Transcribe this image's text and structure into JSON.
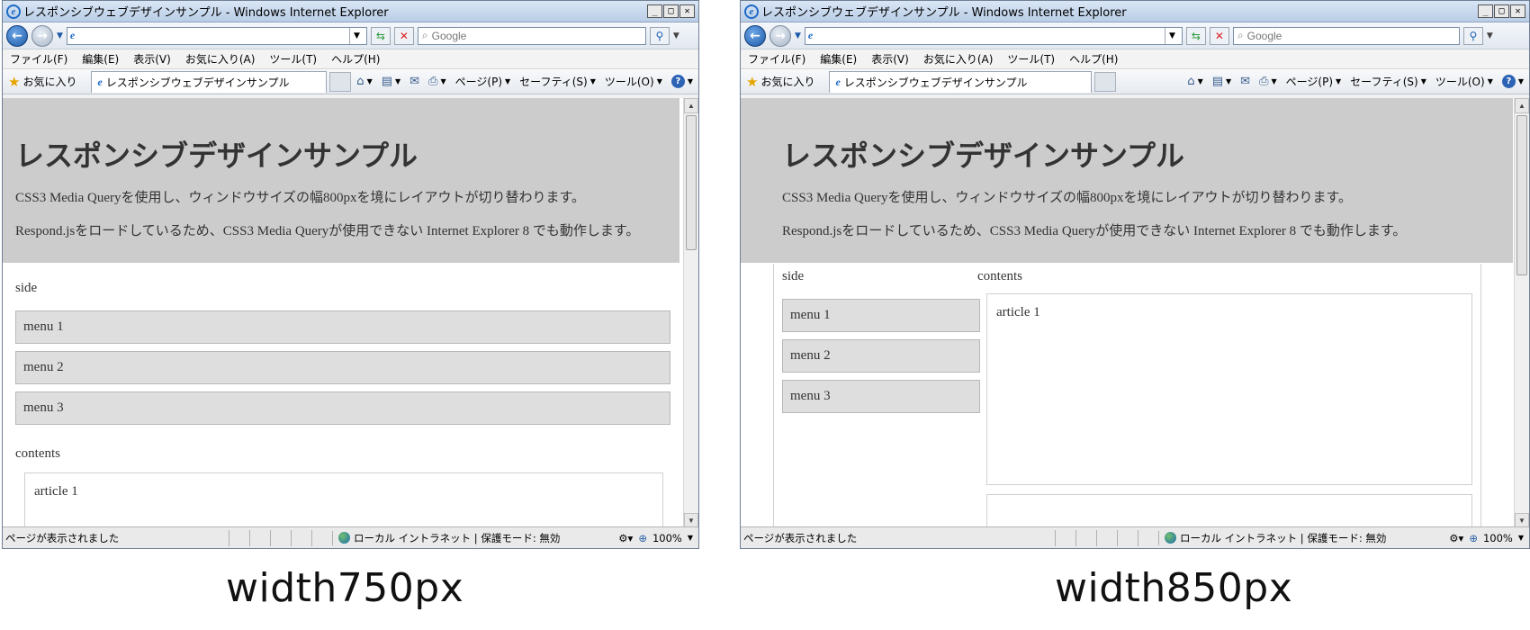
{
  "browser": {
    "title": "レスポンシブウェブデザインサンプル - Windows Internet Explorer",
    "search_placeholder": "Google",
    "menu": [
      "ファイル(F)",
      "編集(E)",
      "表示(V)",
      "お気に入り(A)",
      "ツール(T)",
      "ヘルプ(H)"
    ],
    "favorites_label": "お気に入り",
    "tab_label": "レスポンシブウェブデザインサンプル",
    "commands": {
      "page": "ページ(P)",
      "safety": "セーフティ(S)",
      "tools": "ツール(O)"
    },
    "status_text": "ページが表示されました",
    "zone_text": "ローカル イントラネット | 保護モード: 無効",
    "zoom": "100%"
  },
  "page": {
    "title": "レスポンシブデザインサンプル",
    "desc1": "CSS3 Media Queryを使用し、ウィンドウサイズの幅800pxを境にレイアウトが切り替わります。",
    "desc2": "Respond.jsをロードしているため、CSS3 Media Queryが使用できない Internet Explorer 8 でも動作します。",
    "side_label": "side",
    "menus": [
      "menu 1",
      "menu 2",
      "menu 3"
    ],
    "contents_label": "contents",
    "article1": "article 1"
  },
  "captions": {
    "left": "width750px",
    "right": "width850px"
  }
}
